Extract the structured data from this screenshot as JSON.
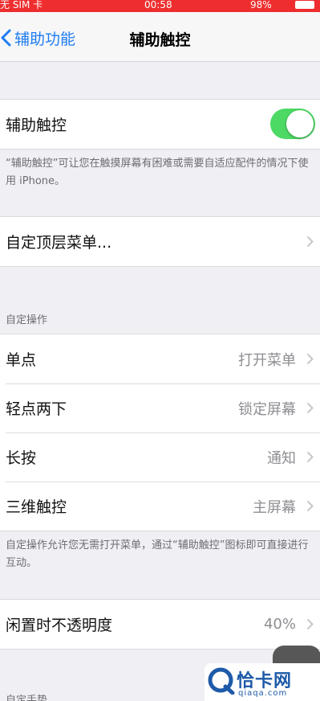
{
  "status_bar": {
    "carrier": "无 SIM 卡",
    "time": "00:58",
    "battery": "98%"
  },
  "nav": {
    "back_label": "辅助功能",
    "title": "辅助触控"
  },
  "toggle_row": {
    "label": "辅助触控",
    "on": true,
    "on_color": "#4cd964"
  },
  "toggle_footnote": "“辅助触控”可让您在触摸屏幕有困难或需要自适应配件的情况下使用 iPhone。",
  "menu_row": {
    "label": "自定顶层菜单..."
  },
  "custom_actions": {
    "header": "自定操作",
    "items": [
      {
        "label": "单点",
        "value": "打开菜单"
      },
      {
        "label": "轻点两下",
        "value": "锁定屏幕"
      },
      {
        "label": "长按",
        "value": "通知"
      },
      {
        "label": "三维触控",
        "value": "主屏幕"
      }
    ],
    "footnote": "自定操作允许您无需打开菜单，通过“辅助触控”图标即可直接进行互动。"
  },
  "opacity_row": {
    "label": "闲置时不透明度",
    "value": "40%"
  },
  "gestures_header": "自定手势",
  "watermark": {
    "title": "恰卡网",
    "url": "qiaqa.com"
  },
  "colors": {
    "accent": "#1e7cf2",
    "status_bar": "#ee2e2e",
    "background": "#efeff4"
  }
}
